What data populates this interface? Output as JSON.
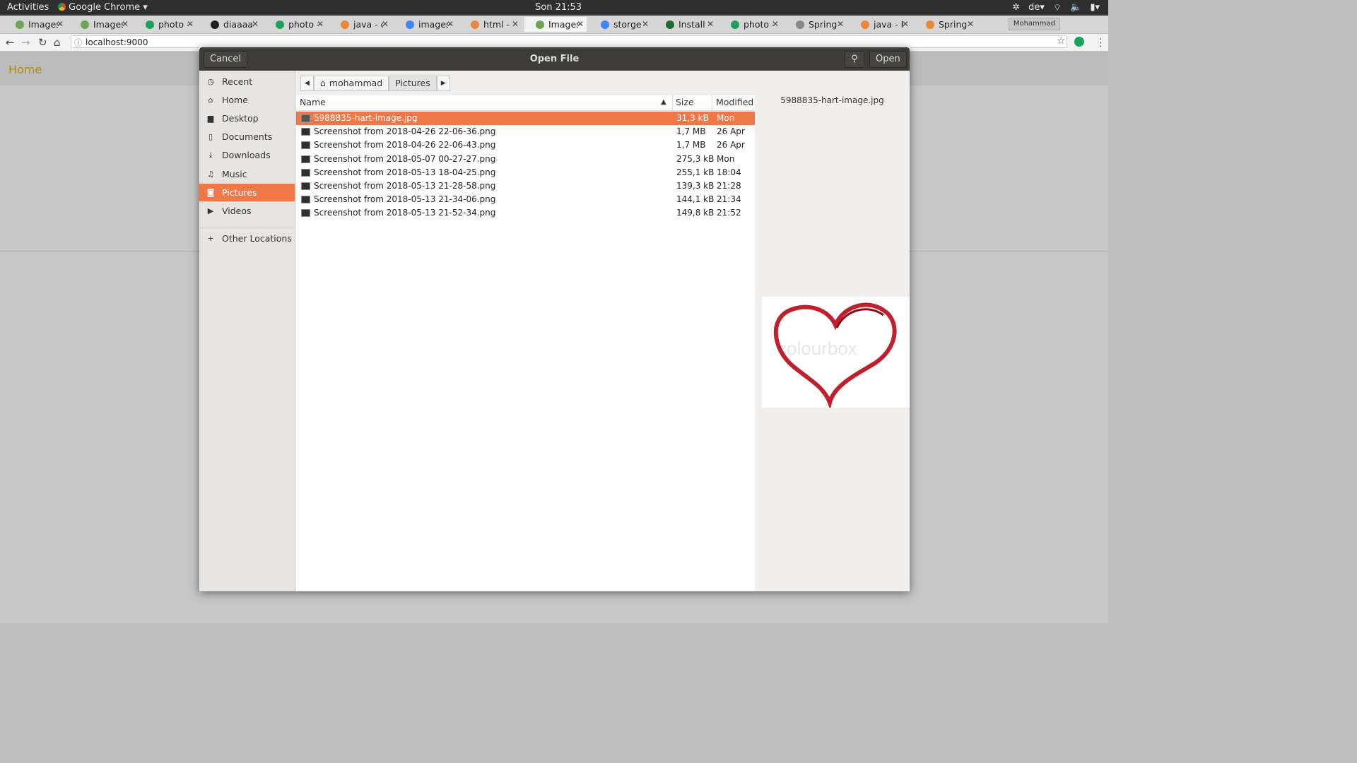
{
  "topbar": {
    "activities": "Activities",
    "app_name": "Google Chrome",
    "clock": "Son 21:53",
    "lang": "de"
  },
  "tabs": [
    {
      "label": "Images",
      "icon": "leaf-icon"
    },
    {
      "label": "Images",
      "icon": "leaf-icon"
    },
    {
      "label": "photo -",
      "icon": "green-circle-icon"
    },
    {
      "label": "diaaaaa",
      "icon": "github-icon"
    },
    {
      "label": "photo -",
      "icon": "green-circle-icon"
    },
    {
      "label": "java - co",
      "icon": "stackoverflow-icon"
    },
    {
      "label": "images",
      "icon": "google-icon"
    },
    {
      "label": "html - I",
      "icon": "stackoverflow-icon"
    },
    {
      "label": "Images",
      "icon": "leaf-icon"
    },
    {
      "label": "storge",
      "icon": "google-icon"
    },
    {
      "label": "Install N",
      "icon": "terminal-icon"
    },
    {
      "label": "photo -",
      "icon": "green-circle-icon"
    },
    {
      "label": "Spring",
      "icon": "page-icon"
    },
    {
      "label": "java - H",
      "icon": "stackoverflow-icon"
    },
    {
      "label": "Spring",
      "icon": "stackoverflow-icon"
    }
  ],
  "profile": "Mohammad",
  "address": {
    "url": "localhost:9000"
  },
  "page": {
    "home_link": "Home"
  },
  "dialog": {
    "title": "Open File",
    "cancel": "Cancel",
    "open": "Open",
    "sidebar": [
      {
        "label": "Recent",
        "icon": "clock-icon"
      },
      {
        "label": "Home",
        "icon": "home-icon"
      },
      {
        "label": "Desktop",
        "icon": "folder-icon"
      },
      {
        "label": "Documents",
        "icon": "document-icon"
      },
      {
        "label": "Downloads",
        "icon": "download-icon"
      },
      {
        "label": "Music",
        "icon": "music-icon"
      },
      {
        "label": "Pictures",
        "icon": "camera-icon"
      },
      {
        "label": "Videos",
        "icon": "video-icon"
      }
    ],
    "other_locations": "Other Locations",
    "path": [
      "mohammad",
      "Pictures"
    ],
    "columns": {
      "name": "Name",
      "size": "Size",
      "modified": "Modified"
    },
    "files": [
      {
        "name": "5988835-hart-image.jpg",
        "size": "31,3 kB",
        "modified": "Mon"
      },
      {
        "name": "Screenshot from 2018-04-26 22-06-36.png",
        "size": "1,7 MB",
        "modified": "26 Apr"
      },
      {
        "name": "Screenshot from 2018-04-26 22-06-43.png",
        "size": "1,7 MB",
        "modified": "26 Apr"
      },
      {
        "name": "Screenshot from 2018-05-07 00-27-27.png",
        "size": "275,3 kB",
        "modified": "Mon"
      },
      {
        "name": "Screenshot from 2018-05-13 18-04-25.png",
        "size": "255,1 kB",
        "modified": "18:04"
      },
      {
        "name": "Screenshot from 2018-05-13 21-28-58.png",
        "size": "139,3 kB",
        "modified": "21:28"
      },
      {
        "name": "Screenshot from 2018-05-13 21-34-06.png",
        "size": "144,1 kB",
        "modified": "21:34"
      },
      {
        "name": "Screenshot from 2018-05-13 21-52-34.png",
        "size": "149,8 kB",
        "modified": "21:52"
      }
    ],
    "preview": {
      "filename": "5988835-hart-image.jpg",
      "watermark": "colourbox"
    }
  },
  "colors": {
    "accent": "#f07746",
    "header": "#3d3c38"
  }
}
